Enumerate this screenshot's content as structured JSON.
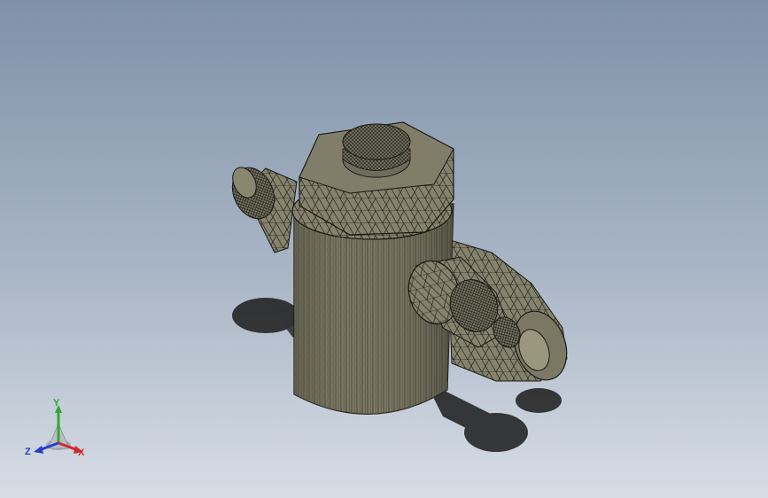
{
  "viewport": {
    "background_top": "#7f91a8",
    "background_bottom": "#d7dde5"
  },
  "model": {
    "body_color": "#6e6c5e",
    "edge_color": "#1a1a14",
    "shadow_color": "#1c1c1c"
  },
  "triad": {
    "x_label": "X",
    "y_label": "Y",
    "z_label": "Z",
    "x_color": "#d22a2a",
    "y_color": "#2fa82f",
    "z_color": "#2a3cc9"
  }
}
